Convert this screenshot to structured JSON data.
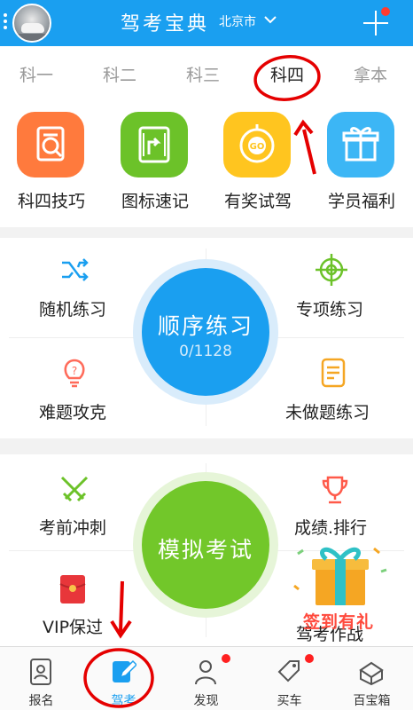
{
  "header": {
    "title": "驾考宝典",
    "city": "北京市",
    "colors": {
      "bar": "#1a9ff0",
      "badge": "#ff3b30"
    }
  },
  "tabs": [
    {
      "label": "科一",
      "active": false
    },
    {
      "label": "科二",
      "active": false
    },
    {
      "label": "科三",
      "active": false
    },
    {
      "label": "科四",
      "active": true
    },
    {
      "label": "拿本",
      "active": false
    }
  ],
  "features": [
    {
      "label": "科四技巧",
      "icon": "certificate-search-icon",
      "color": "#ff7a3d"
    },
    {
      "label": "图标速记",
      "icon": "road-sign-icon",
      "color": "#6cc229"
    },
    {
      "label": "有奖试驾",
      "icon": "go-steering-icon",
      "color": "#ffc51f"
    },
    {
      "label": "学员福利",
      "icon": "gift-box-icon",
      "color": "#3cb6f5"
    }
  ],
  "practice": {
    "random": "随机练习",
    "special": "专项练习",
    "difficult": "难题攻克",
    "undone": "未做题练习",
    "sequential": {
      "title": "顺序练习",
      "progress": "0/1128"
    }
  },
  "exam": {
    "sprint": "考前冲刺",
    "ranking": "成绩.排行",
    "vip": "VIP保过",
    "battle": "驾考作战",
    "mock": {
      "title": "模拟考试"
    },
    "signin": "签到有礼"
  },
  "bottom_nav": [
    {
      "label": "报名",
      "icon": "id-card-icon",
      "active": false,
      "badge": false
    },
    {
      "label": "驾考",
      "icon": "edit-doc-icon",
      "active": true,
      "badge": false
    },
    {
      "label": "发现",
      "icon": "person-icon",
      "active": false,
      "badge": true
    },
    {
      "label": "买车",
      "icon": "price-tag-icon",
      "active": false,
      "badge": true
    },
    {
      "label": "百宝箱",
      "icon": "treasure-box-icon",
      "active": false,
      "badge": false
    }
  ]
}
